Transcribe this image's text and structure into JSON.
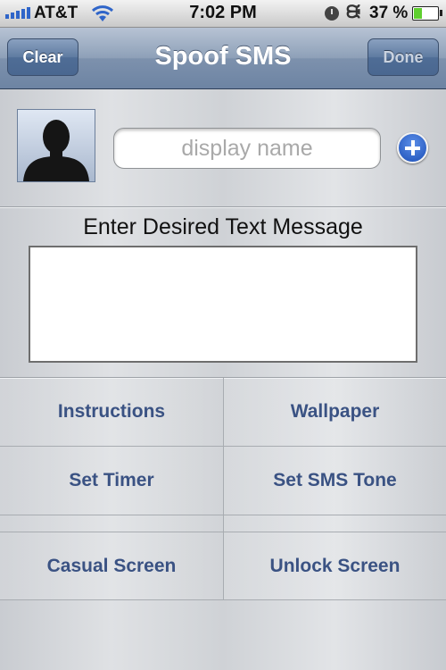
{
  "status_bar": {
    "carrier": "AT&T",
    "time": "7:02 PM",
    "bluetooth_icon": "ᙠ",
    "battery_percent": "37 %",
    "battery_level": 0.37,
    "signal_bars": 5
  },
  "nav": {
    "title": "Spoof SMS",
    "left_button": "Clear",
    "right_button": "Done"
  },
  "contact": {
    "name_placeholder": "display name"
  },
  "message": {
    "label": "Enter Desired Text Message",
    "value": ""
  },
  "menu": {
    "instructions": "Instructions",
    "wallpaper": "Wallpaper",
    "set_timer": "Set Timer",
    "set_sms_tone": "Set SMS Tone",
    "casual_screen": "Casual Screen",
    "unlock_screen": "Unlock Screen"
  },
  "colors": {
    "accent_blue": "#3a5283",
    "nav_blue": "#7d91ad"
  }
}
